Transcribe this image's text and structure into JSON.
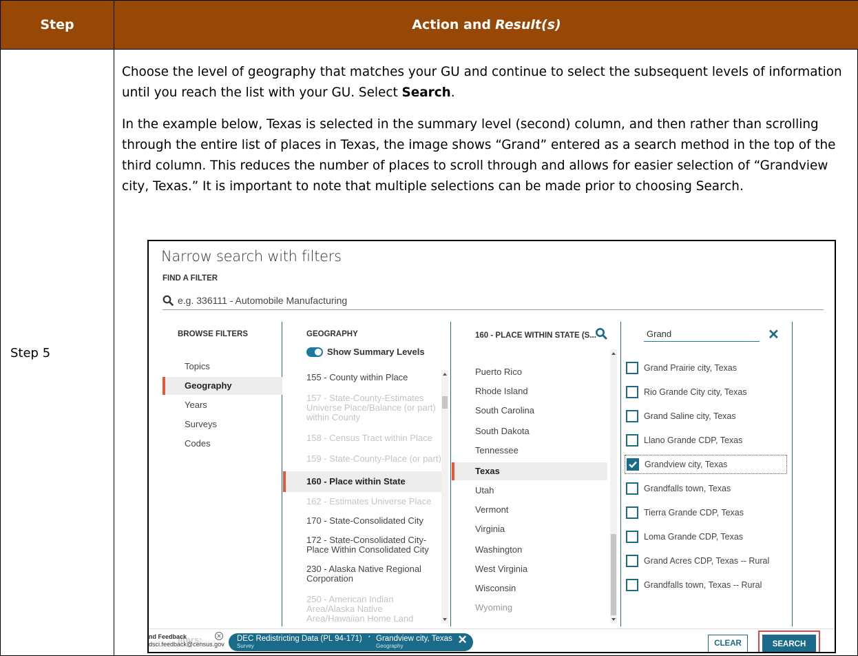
{
  "header": {
    "step_col": "Step",
    "action_col": "Action and",
    "action_col_italic": "Result(s)"
  },
  "step_label": "Step 5",
  "para1": {
    "before": "Choose the level of geography that matches your GU and continue to select the subsequent levels of information until you reach the list with your GU. Select ",
    "bold": "Search",
    "after": "."
  },
  "para2": "In the example below, Texas is selected in the summary level (second) column, and then rather than scrolling through the entire list of places in Texas, the image shows “Grand” entered as a search method in the top of the third column. This reduces the number of places to scroll through and allows for easier selection of “Grandview city, Texas.” It is important to note that multiple selections can be made prior to choosing Search.",
  "screenshot": {
    "title": "Narrow search with filters",
    "find_label": "FIND A FILTER",
    "find_placeholder": "e.g. 336111 - Automobile Manufacturing",
    "browse": {
      "heading": "BROWSE FILTERS",
      "items": [
        "Topics",
        "Geography",
        "Years",
        "Surveys",
        "Codes"
      ],
      "active": "Geography"
    },
    "geography": {
      "heading": "GEOGRAPHY",
      "toggle_label": "Show Summary Levels",
      "items": [
        "155 - County within Place",
        "157 - State-County-Estimates Universe Place/Balance (or part) within County",
        "158 - Census Tract within Place",
        "159 - State-County-Place (or part)",
        "160 - Place within State",
        "162 - Estimates Universe Place",
        "170 - State-Consolidated City",
        "172 - State-Consolidated City-Place Within Consolidated City",
        "230 - Alaska Native Regional Corporation",
        "250 - American Indian Area/Alaska Native Area/Hawaiian Home Land"
      ]
    },
    "places": {
      "heading": "160 - PLACE WITHIN STATE (S...",
      "items": [
        "Puerto Rico",
        "Rhode Island",
        "South Carolina",
        "South Dakota",
        "Tennessee",
        "Texas",
        "Utah",
        "Vermont",
        "Virginia",
        "Washington",
        "West Virginia",
        "Wisconsin",
        "Wyoming"
      ],
      "active": "Texas"
    },
    "results": {
      "search_value": "Grand",
      "items": [
        {
          "label": "Grand Prairie city, Texas",
          "checked": false
        },
        {
          "label": "Rio Grande City city, Texas",
          "checked": false
        },
        {
          "label": "Grand Saline city, Texas",
          "checked": false
        },
        {
          "label": "Llano Grande CDP, Texas",
          "checked": false
        },
        {
          "label": "Grandview city, Texas",
          "checked": true
        },
        {
          "label": "Grandfalls town, Texas",
          "checked": false
        },
        {
          "label": "Tierra Grande CDP, Texas",
          "checked": false
        },
        {
          "label": "Loma Grande CDP, Texas",
          "checked": false
        },
        {
          "label": "Grand Acres CDP, Texas -- Rural",
          "checked": false
        },
        {
          "label": "Grandfalls town, Texas -- Rural",
          "checked": false
        }
      ]
    },
    "footer": {
      "feedback_title": "nd Feedback",
      "feedback_email": "dsci.feedback@census.gov",
      "ghost": "ilters:",
      "chip1_label": "DEC Redistricting Data (PL 94-171)",
      "chip1_sub": "Survey",
      "chip2_label": "Grandview city, Texas",
      "chip2_sub": "Geography",
      "clear_label": "CLEAR",
      "search_label": "SEARCH"
    },
    "colors": {
      "header_bg": "#974806",
      "accent": "#1a6b8a",
      "active_marker": "#e8563a",
      "highlight_border": "#e04848"
    }
  }
}
